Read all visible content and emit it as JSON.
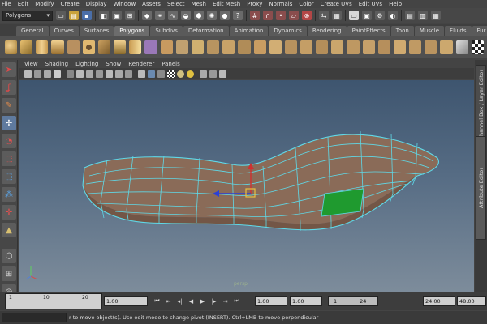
{
  "menubar": [
    "File",
    "Edit",
    "Modify",
    "Create",
    "Display",
    "Window",
    "Assets",
    "Select",
    "Mesh",
    "Edit Mesh",
    "Proxy",
    "Normals",
    "Color",
    "Create UVs",
    "Edit UVs",
    "Help"
  ],
  "status": {
    "mode": "Polygons"
  },
  "shelf_tabs": [
    "General",
    "Curves",
    "Surfaces",
    "Polygons",
    "Subdivs",
    "Deformation",
    "Animation",
    "Dynamics",
    "Rendering",
    "PaintEffects",
    "Toon",
    "Muscle",
    "Fluids",
    "Fur"
  ],
  "active_shelf_tab": "Polygons",
  "panel_menu": [
    "View",
    "Shading",
    "Lighting",
    "Show",
    "Renderer",
    "Panels"
  ],
  "viewport": {
    "camera_label": "persp"
  },
  "side_tabs": [
    "Channel Box / Layer Editor",
    "Attribute Editor"
  ],
  "timeline": {
    "ticks": [
      "1",
      "10",
      "20"
    ],
    "current_frame": "1.00",
    "range_start": "1.00",
    "playback_start": "1.00",
    "range_slider_start": "1",
    "range_slider_end": "24",
    "playback_end": "24.00",
    "end_time": "48.00"
  },
  "help_line": "r to move object(s). Use edit mode to change pivot (INSERT).  Ctrl+LMB to move perpendicular",
  "colors": {
    "mesh_face": "#8a6b58",
    "mesh_wire": "#5fd9e8",
    "selected_face": "#1f9a2f",
    "viewport_top": "#3e556f",
    "viewport_bottom": "#7d8c9b"
  }
}
